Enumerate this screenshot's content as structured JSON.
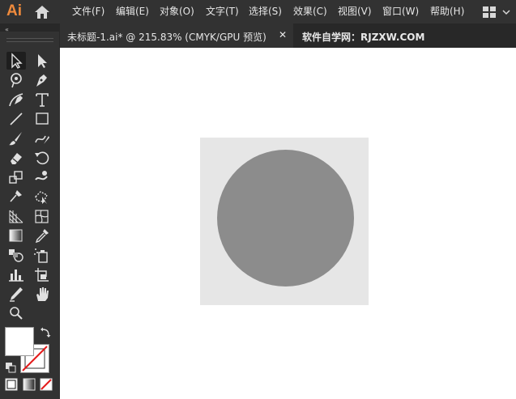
{
  "app": {
    "logo_text": "Ai",
    "brand_color": "#ef8a3c"
  },
  "menu": {
    "items": [
      {
        "label": "文件(F)"
      },
      {
        "label": "编辑(E)"
      },
      {
        "label": "对象(O)"
      },
      {
        "label": "文字(T)"
      },
      {
        "label": "选择(S)"
      },
      {
        "label": "效果(C)"
      },
      {
        "label": "视图(V)"
      },
      {
        "label": "窗口(W)"
      },
      {
        "label": "帮助(H)"
      }
    ],
    "workspace_switcher": "grid-icon",
    "home": "home-icon"
  },
  "tabs": {
    "collapse": "«",
    "document": {
      "title": "未标题-1.ai* @ 215.83% (CMYK/GPU 预览)",
      "close": "✕"
    },
    "watermark": "软件自学网：RJZXW.COM"
  },
  "tools": [
    "selection-tool",
    "direct-selection-tool",
    "magic-wand-tool",
    "pen-tool",
    "curvature-tool",
    "type-tool",
    "line-tool",
    "rectangle-tool",
    "paintbrush-tool",
    "shaper-tool",
    "eraser-tool",
    "rotate-tool",
    "scale-tool",
    "warp-tool",
    "puppet-warp-tool",
    "free-transform-tool",
    "perspective-grid-tool",
    "mesh-tool",
    "gradient-tool",
    "eyedropper-tool",
    "blend-tool",
    "symbol-sprayer-tool",
    "graph-tool",
    "artboard-tool",
    "slice-tool",
    "hand-tool",
    "zoom-tool"
  ],
  "colors": {
    "canvas_bg": "#ffffff",
    "artboard_fill": "#e6e6e6",
    "circle_fill": "#8c8c8c",
    "panel_bg": "#323232",
    "tab_bar_bg": "#282828",
    "fill_swatch": "#ffffff",
    "stroke_swatch": "none"
  },
  "canvas": {
    "shapes": [
      "rectangle",
      "circle"
    ]
  },
  "color_modes": [
    "color",
    "gradient",
    "none"
  ]
}
